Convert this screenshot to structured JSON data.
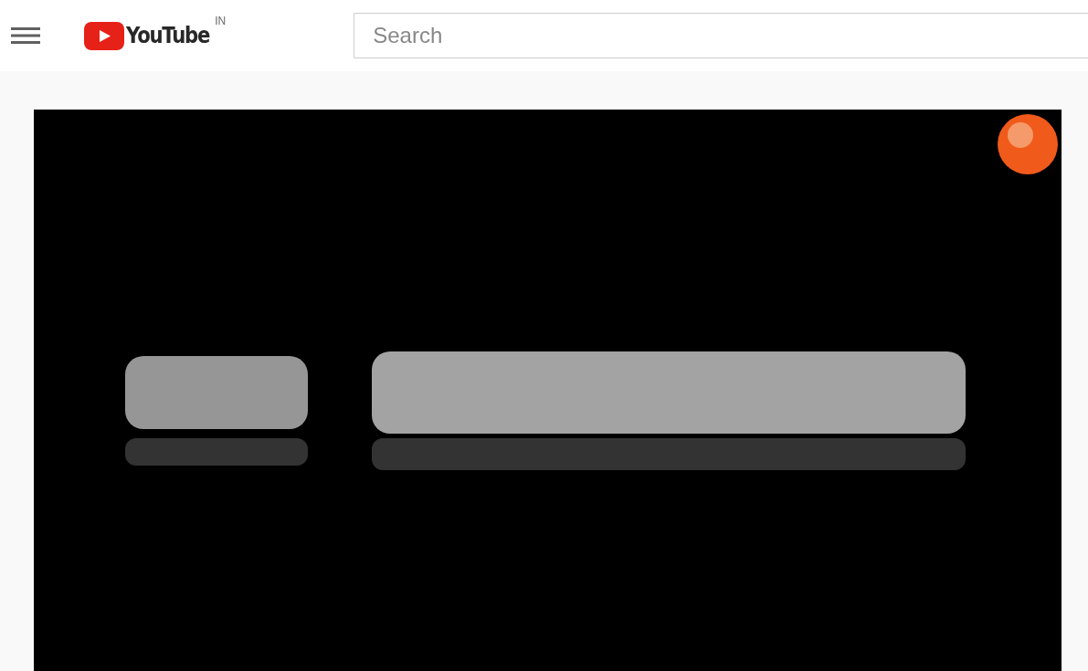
{
  "header": {
    "logo_text": "YouTube",
    "region": "IN"
  },
  "search": {
    "placeholder": "Search"
  }
}
